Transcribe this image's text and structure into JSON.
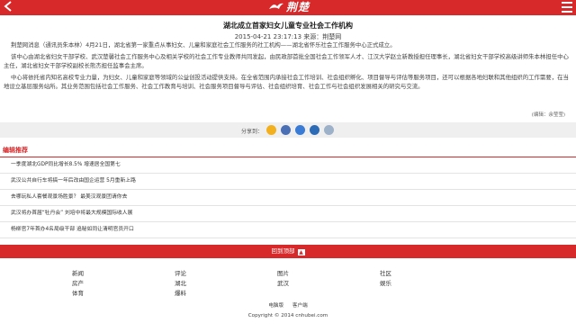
{
  "header": {
    "logo_text": "荆楚",
    "brand_color": "#d7282a"
  },
  "article": {
    "title": "湖北成立首家妇女儿童专业社会工作机构",
    "date": "2015-04-21 23:17:13",
    "source_label": "来源：荆楚网",
    "paragraphs": [
      "荆楚网消息（通讯员朱本林）4月21日，湖北省第一家重点从事妇女、儿童和家庭社会工作服务的社工机构——湖北省怀乐社会工作服务中心正式成立。",
      "该中心由湖北省妇女干部学校、武汉楚馨社会工作服务中心及相关学校的社会工作专业教师共同发起，由民政部首批全国社会工作领军人才、江汉大学赵立新教授担任理事长，湖北省妇女干部学校高级讲师朱本林担任中心主任，湖北省妇女干部学校副校长熊杰担任监事会主席。",
      "中心将依托省内知名高校专业力量，为妇女、儿童和家庭等领域的公益创投活动提供支持。在全省范围内承接社会工作培训、社会组织孵化、项目督导与评估等服务项目，还可以根据各地妇联和其他组织的工作需要，在当地设立基层服务站所。其业务范围包括社会工作服务、社会工作教育与培训、社会服务项目督导与评估、社会组织培育、社会工作与社会组织发展相关的研究与交流。"
    ],
    "editor": "(编辑：余莹莹)"
  },
  "share": {
    "label": "分享到：",
    "icons": [
      {
        "name": "qzone-icon",
        "color": "#f2b01e"
      },
      {
        "name": "weibo-icon",
        "color": "#4a6fb5"
      },
      {
        "name": "tencent-weibo-icon",
        "color": "#3a7bd5"
      },
      {
        "name": "renren-icon",
        "color": "#2d6bb7"
      },
      {
        "name": "more-icon",
        "color": "#9db1c9"
      }
    ]
  },
  "recommend": {
    "heading": "编辑推荐",
    "items": [
      "一季度湖北GDP同比增长8.5% 增速居全国第七",
      "武汉公共自行车将搞一年后改由国企运营 5月重新上路",
      "去哪玩私人套餐观景场胜景？ 最美汉观景团请你去",
      "武汉将办首届“牡丹会” 刘培中将最大规模国际收人展",
      "杨柳官7年首办4名局级干部 追秘如同让清明官员开口"
    ]
  },
  "back_to_top": {
    "label": "回到顶部"
  },
  "footer": {
    "nav_rows": [
      [
        "新闻",
        "评论",
        "图片",
        "社区"
      ],
      [
        "房产",
        "湖北",
        "武汉",
        "娱乐"
      ],
      [
        "体育",
        "爆料"
      ]
    ],
    "links": [
      "电脑版",
      "客户端"
    ],
    "copyright": "Copyright © 2014 cnhubei.com"
  }
}
